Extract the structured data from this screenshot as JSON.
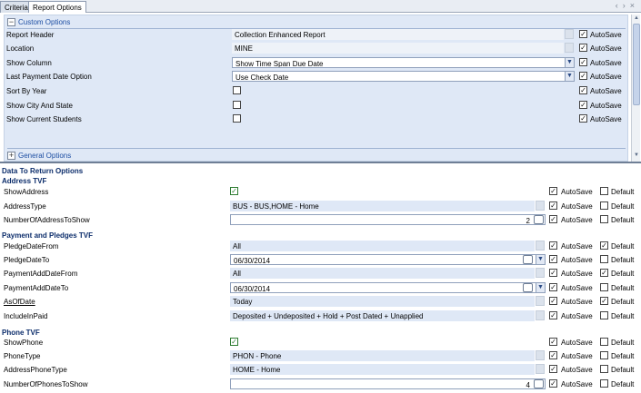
{
  "tabs": [
    {
      "label": "Criteria"
    },
    {
      "label": "Report Options"
    }
  ],
  "tab_nav": {
    "prev": "‹",
    "next": "›",
    "close": "×"
  },
  "custom_options": {
    "header": "Custom Options",
    "expander": "−",
    "rows": [
      {
        "label": "Report Header",
        "value": "Collection Enhanced Report",
        "autosave": "AutoSave"
      },
      {
        "label": "Location",
        "value": "MINE",
        "autosave": "AutoSave"
      },
      {
        "label": "Show Column",
        "value": "Show Time Span Due Date",
        "autosave": "AutoSave"
      },
      {
        "label": "Last Payment Date Option",
        "value": "Use Check Date",
        "autosave": "AutoSave"
      },
      {
        "label": "Sort By Year",
        "value": "",
        "autosave": "AutoSave"
      },
      {
        "label": "Show City And State",
        "value": "",
        "autosave": "AutoSave"
      },
      {
        "label": "Show Current Students",
        "value": "",
        "autosave": "AutoSave"
      }
    ]
  },
  "general_options": {
    "header": "General Options",
    "expander": "+"
  },
  "data_options": {
    "title": "Data To Return Options",
    "sections": [
      {
        "title": "Address TVF"
      },
      {
        "title": "Payment and Pledges TVF"
      },
      {
        "title": "Phone TVF"
      }
    ],
    "rows": [
      {
        "label": "ShowAddress",
        "value": "",
        "autosave": "AutoSave",
        "default": "Default"
      },
      {
        "label": "AddressType",
        "value": "BUS - BUS,HOME - Home",
        "autosave": "AutoSave",
        "default": "Default"
      },
      {
        "label": "NumberOfAddressToShow",
        "value": "2",
        "autosave": "AutoSave",
        "default": "Default"
      },
      {
        "label": "PledgeDateFrom",
        "value": "All",
        "autosave": "AutoSave",
        "default": "Default"
      },
      {
        "label": "PledgeDateTo",
        "value": "06/30/2014",
        "autosave": "AutoSave",
        "default": "Default"
      },
      {
        "label": "PaymentAddDateFrom",
        "value": "All",
        "autosave": "AutoSave",
        "default": "Default"
      },
      {
        "label": "PaymentAddDateTo",
        "value": "06/30/2014",
        "autosave": "AutoSave",
        "default": "Default"
      },
      {
        "label": "AsOfDate",
        "value": "Today",
        "autosave": "AutoSave",
        "default": "Default"
      },
      {
        "label": "IncludeInPaid",
        "value": "Deposited + Undeposited + Hold + Post Dated + Unapplied",
        "autosave": "AutoSave",
        "default": "Default"
      },
      {
        "label": "ShowPhone",
        "value": "",
        "autosave": "AutoSave",
        "default": "Default"
      },
      {
        "label": "PhoneType",
        "value": "PHON - Phone",
        "autosave": "AutoSave",
        "default": "Default"
      },
      {
        "label": "AddressPhoneType",
        "value": "HOME - Home",
        "autosave": "AutoSave",
        "default": "Default"
      },
      {
        "label": "NumberOfPhonesToShow",
        "value": "4",
        "autosave": "AutoSave",
        "default": "Default"
      }
    ]
  },
  "glyphs": {
    "check": "✓",
    "dropdown": "▼",
    "up": "▲",
    "down": "▼"
  },
  "colors": {
    "panel_bg": "#dfe8f6",
    "section_title": "#0c2d6b",
    "link": "#1e4fa3"
  }
}
